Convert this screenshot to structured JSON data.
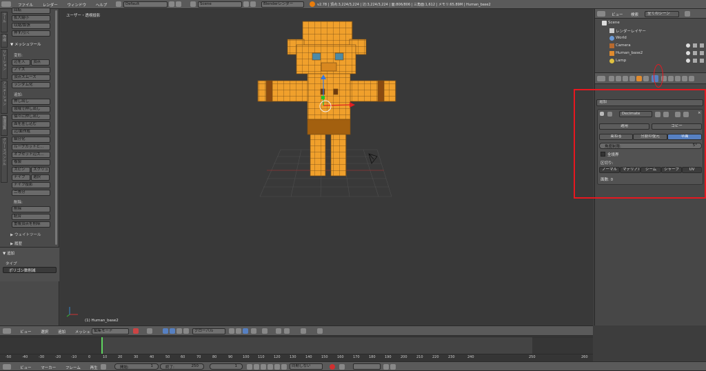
{
  "topbar": {
    "menus": [
      "ファイル",
      "レンダー",
      "ウィンドウ",
      "ヘルプ"
    ],
    "layout": "Default",
    "scene": "Scene",
    "engine": "Blenderレンダー",
    "stats": "v2.78 | 頂点:3,224/3,224 | 辺:3,224/3,224 | 面:806/806 | 三角面:1,612 | メモリ:65.89M | Human_base2"
  },
  "left_panel": {
    "tools_top": [
      "回転",
      "拡大縮小",
      "収縮/膨張",
      "押す/引く"
    ],
    "mesh_tools_header": "▼ メッシュツール",
    "deform_label": "変形:",
    "deform": [
      [
        "辺を入",
        "頂点"
      ],
      [
        "ノイズ"
      ],
      [
        "頂点スムーズ"
      ],
      [
        "ランダム化"
      ]
    ],
    "add_label": "追加:",
    "extrude": "押し出し",
    "add_tools": [
      "領域で押し出し",
      "個々に押し出し",
      "面を差し込む",
      "辺/面作成",
      "細分化",
      "ループカットと...",
      "オフセット辺ス...",
      "複製"
    ],
    "spin": [
      "スピン",
      "スクリュ"
    ],
    "knife": [
      "ナイフ",
      "選択"
    ],
    "knife_project": "ナイフ投影",
    "bisect": "二等分",
    "remove_label": "削除:",
    "remove": [
      "削除",
      "統合",
      "重複頂点を削除"
    ],
    "weight_tools": "▶ ウェイトツール",
    "history": "▶ 履歴",
    "add_section": "▼ 追加",
    "type_label": "タイプ",
    "type_value": "ポリゴン数削減",
    "vertical_tabs": [
      "ツール",
      "作成",
      "リレーション",
      "アニメーション",
      "物理演算",
      "グリースペンシル"
    ]
  },
  "viewport": {
    "title": "ユーザー・透視投影",
    "object_label": "(1) Human_base2"
  },
  "viewport_header": {
    "menus": [
      "ビュー",
      "選択",
      "追加",
      "メッシュ"
    ],
    "mode": "編集モード",
    "orientation": "グローバル"
  },
  "outliner": {
    "menus": [
      "ビュー",
      "検索"
    ],
    "filter": "全てのシーン",
    "items": [
      "Scene",
      "レンダーレイヤー",
      "World",
      "Camera",
      "Human_base2",
      "Lamp"
    ]
  },
  "properties": {
    "add_dropdown": "追加",
    "modifier_name": "Decimate",
    "apply": "適用",
    "copy": "コピー",
    "modes": [
      "束ねる",
      "分割の復元",
      "平面"
    ],
    "active_mode_index": 2,
    "angle_label": "角度制限:",
    "angle_value": "5°",
    "all_boundaries": "全境界",
    "delimit_label": "区切り:",
    "delimit": [
      "ノーマル",
      "マテリアル",
      "シーム",
      "シャープ",
      "UV"
    ],
    "face_count": "面数: 0"
  },
  "timeline": {
    "menus": [
      "ビュー",
      "マーカー",
      "フレーム",
      "再生"
    ],
    "start_label": "開始:",
    "start_value": "1",
    "end_label": "終了:",
    "end_value": "250",
    "current_frame": "1",
    "sync": "同期しない",
    "ticks": [
      "-50",
      "-40",
      "-30",
      "-20",
      "-10",
      "0",
      "10",
      "20",
      "30",
      "40",
      "50",
      "60",
      "70",
      "80",
      "90",
      "100",
      "110",
      "120",
      "130",
      "140",
      "150",
      "160",
      "170",
      "180",
      "190",
      "200",
      "210",
      "220",
      "230",
      "240",
      "250",
      "260"
    ]
  },
  "colors": {
    "mesh": "#f0a02c",
    "highlight": "#e8171f",
    "active_tab": "#5680c2",
    "frame_marker": "#5fd55f"
  }
}
